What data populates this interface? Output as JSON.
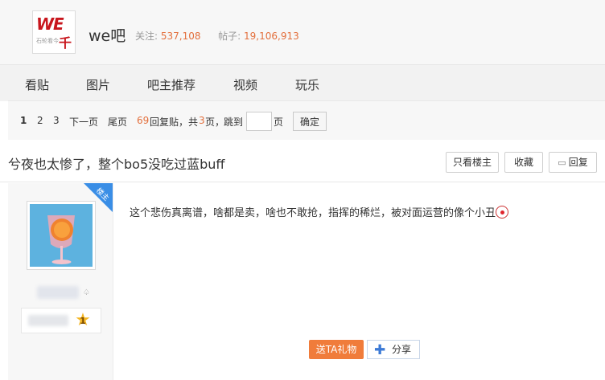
{
  "forum": {
    "name": "we吧",
    "logo_text": "WE",
    "logo_char": "千",
    "logo_sub": "石轮看今",
    "follow_label": "关注:",
    "follow_count": "537,108",
    "posts_label": "帖子:",
    "posts_count": "19,106,913"
  },
  "tabs": [
    "看贴",
    "图片",
    "吧主推荐",
    "视频",
    "玩乐"
  ],
  "pager": {
    "page1": "1",
    "page2": "2",
    "page3": "3",
    "next": "下一页",
    "last": "尾页",
    "reply_count": "69",
    "reply_label": "回复贴，共",
    "total_pages": "3",
    "pages_suffix": "页，",
    "jump_label": "跳到",
    "page_unit": "页",
    "confirm": "确定"
  },
  "thread": {
    "title": "兮夜也太惨了，整个bo5没吃过蓝buff",
    "only_op": "只看楼主",
    "favorite": "收藏",
    "reply": "回复"
  },
  "post": {
    "badge": "楼主",
    "level": "1",
    "content": "这个悲伤真离谱，啥都是卖，啥也不敢抢，指挥的稀烂，被对面运营的像个小丑",
    "gift_button": "送TA礼物",
    "share_button": "分享"
  },
  "colors": {
    "accent_orange": "#e36f3c",
    "badge_blue": "#3a8ee6",
    "gift_orange": "#f07c3b"
  }
}
